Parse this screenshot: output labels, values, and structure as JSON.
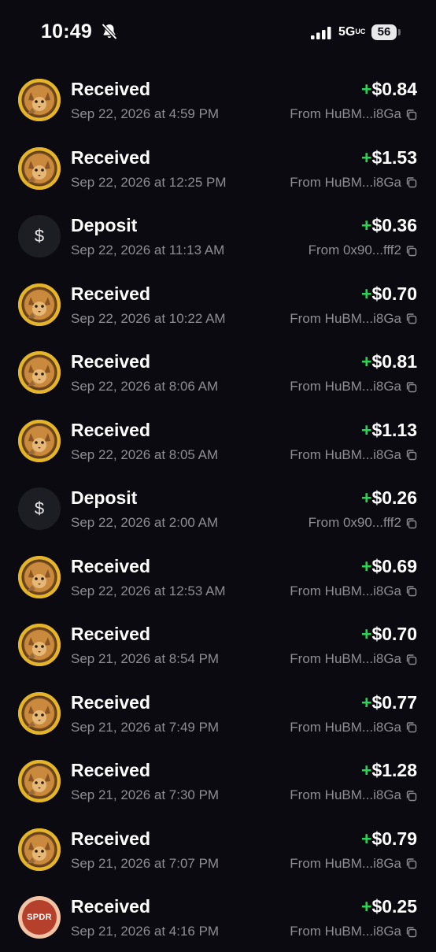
{
  "status_bar": {
    "time": "10:49",
    "network": "5G",
    "network_sub": "UC",
    "battery": "56",
    "icons": [
      "bell-slash-icon",
      "signal-bars-icon",
      "battery-icon"
    ]
  },
  "colors": {
    "background": "#0b0a10",
    "positive": "#2fd15a",
    "secondary_text": "#8e8d95"
  },
  "transactions": [
    {
      "avatar": "cat-token",
      "title": "Received",
      "date": "Sep 22, 2026 at 4:59 PM",
      "plus": "+",
      "amount": "$0.84",
      "source": "From HuBM...i8Ga"
    },
    {
      "avatar": "cat-token",
      "title": "Received",
      "date": "Sep 22, 2026 at 12:25 PM",
      "plus": "+",
      "amount": "$1.53",
      "source": "From HuBM...i8Ga"
    },
    {
      "avatar": "dollar",
      "avatar_symbol": "$",
      "title": "Deposit",
      "date": "Sep 22, 2026 at 11:13 AM",
      "plus": "+",
      "amount": "$0.36",
      "source": "From 0x90...fff2"
    },
    {
      "avatar": "cat-token",
      "title": "Received",
      "date": "Sep 22, 2026 at 10:22 AM",
      "plus": "+",
      "amount": "$0.70",
      "source": "From HuBM...i8Ga"
    },
    {
      "avatar": "cat-token",
      "title": "Received",
      "date": "Sep 22, 2026 at 8:06 AM",
      "plus": "+",
      "amount": "$0.81",
      "source": "From HuBM...i8Ga"
    },
    {
      "avatar": "cat-token",
      "title": "Received",
      "date": "Sep 22, 2026 at 8:05 AM",
      "plus": "+",
      "amount": "$1.13",
      "source": "From HuBM...i8Ga"
    },
    {
      "avatar": "dollar",
      "avatar_symbol": "$",
      "title": "Deposit",
      "date": "Sep 22, 2026 at 2:00 AM",
      "plus": "+",
      "amount": "$0.26",
      "source": "From 0x90...fff2"
    },
    {
      "avatar": "cat-token",
      "title": "Received",
      "date": "Sep 22, 2026 at 12:53 AM",
      "plus": "+",
      "amount": "$0.69",
      "source": "From HuBM...i8Ga"
    },
    {
      "avatar": "cat-token",
      "title": "Received",
      "date": "Sep 21, 2026 at 8:54 PM",
      "plus": "+",
      "amount": "$0.70",
      "source": "From HuBM...i8Ga"
    },
    {
      "avatar": "cat-token",
      "title": "Received",
      "date": "Sep 21, 2026 at 7:49 PM",
      "plus": "+",
      "amount": "$0.77",
      "source": "From HuBM...i8Ga"
    },
    {
      "avatar": "cat-token",
      "title": "Received",
      "date": "Sep 21, 2026 at 7:30 PM",
      "plus": "+",
      "amount": "$1.28",
      "source": "From HuBM...i8Ga"
    },
    {
      "avatar": "cat-token",
      "title": "Received",
      "date": "Sep 21, 2026 at 7:07 PM",
      "plus": "+",
      "amount": "$0.79",
      "source": "From HuBM...i8Ga"
    },
    {
      "avatar": "spdr",
      "avatar_symbol": "SPDR",
      "title": "Received",
      "date": "Sep 21, 2026 at 4:16 PM",
      "plus": "+",
      "amount": "$0.25",
      "source": "From HuBM...i8Ga"
    }
  ]
}
